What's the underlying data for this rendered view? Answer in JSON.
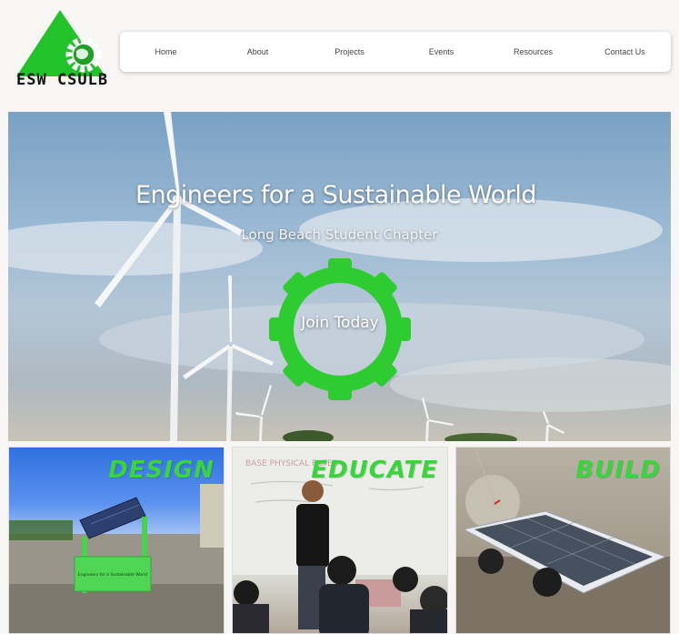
{
  "brand": {
    "logo_text": "ESW CSULB",
    "color": "#22c32a"
  },
  "nav": {
    "items": [
      "Home",
      "About",
      "Projects",
      "Events",
      "Resources",
      "Contact Us"
    ]
  },
  "hero": {
    "title": "Engineers for a Sustainable World",
    "subtitle": "Long Beach Student Chapter",
    "cta_label": "Join Today",
    "gear_color": "#2ecc31"
  },
  "cards": [
    {
      "label": "DESIGN",
      "sign_text": "Engineers for a Sustainable World"
    },
    {
      "label": "EDUCATE",
      "board_text": "BASE PHYSICAL FILTER"
    },
    {
      "label": "BUILD"
    }
  ],
  "icons": [
    "triangle-logo-icon",
    "globe-icon",
    "gear-icon"
  ]
}
